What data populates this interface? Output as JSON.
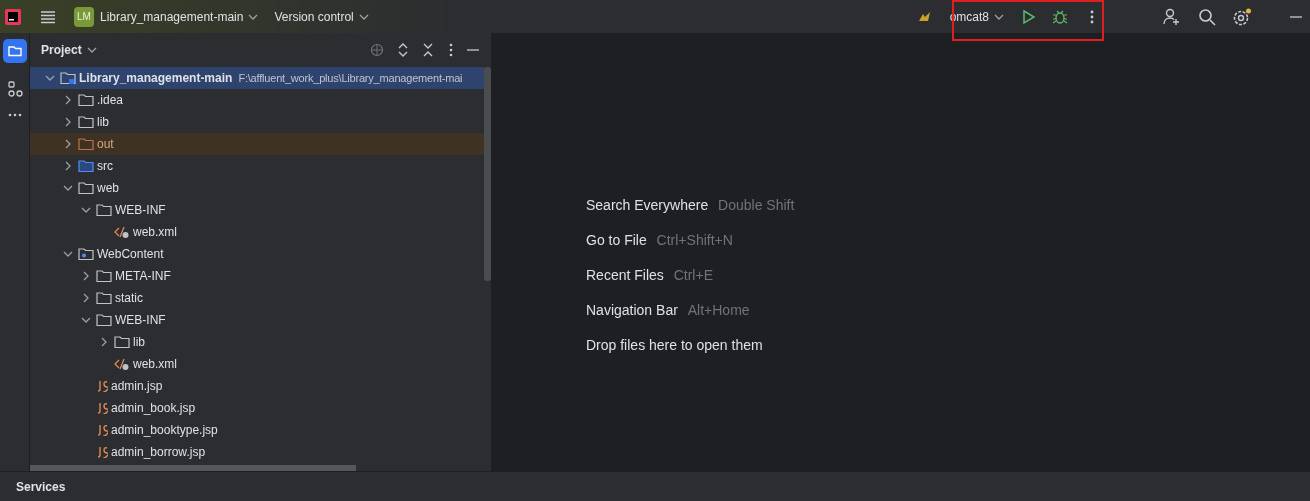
{
  "toolbar": {
    "project_badge": "LM",
    "project_name": "Library_management-main",
    "vcs": "Version control",
    "run_config": "omcat8"
  },
  "project_panel": {
    "title": "Project",
    "tree": [
      {
        "name": "Library_management-main",
        "path": "F:\\affluent_work_plus\\Library_management-mai",
        "kind": "module",
        "expanded": true,
        "selected": true,
        "excluded": false,
        "children": [
          {
            "name": ".idea",
            "kind": "folder",
            "expanded": false,
            "selected": false,
            "excluded": false
          },
          {
            "name": "lib",
            "kind": "folder",
            "expanded": false,
            "selected": false,
            "excluded": false
          },
          {
            "name": "out",
            "kind": "folder",
            "expanded": false,
            "selected": false,
            "excluded": true
          },
          {
            "name": "src",
            "kind": "source-folder",
            "expanded": false,
            "selected": false,
            "excluded": false
          },
          {
            "name": "web",
            "kind": "folder",
            "expanded": true,
            "selected": false,
            "excluded": false,
            "children": [
              {
                "name": "WEB-INF",
                "kind": "folder",
                "expanded": true,
                "selected": false,
                "excluded": false,
                "children": [
                  {
                    "name": "web.xml",
                    "kind": "xml",
                    "selected": false,
                    "excluded": false
                  }
                ]
              }
            ]
          },
          {
            "name": "WebContent",
            "kind": "web-folder",
            "expanded": true,
            "selected": false,
            "excluded": false,
            "children": [
              {
                "name": "META-INF",
                "kind": "folder",
                "expanded": false,
                "selected": false,
                "excluded": false
              },
              {
                "name": "static",
                "kind": "folder",
                "expanded": false,
                "selected": false,
                "excluded": false
              },
              {
                "name": "WEB-INF",
                "kind": "folder",
                "expanded": true,
                "selected": false,
                "excluded": false,
                "children": [
                  {
                    "name": "lib",
                    "kind": "folder",
                    "expanded": false,
                    "selected": false,
                    "excluded": false
                  },
                  {
                    "name": "web.xml",
                    "kind": "xml",
                    "selected": false,
                    "excluded": false
                  }
                ]
              },
              {
                "name": "admin.jsp",
                "kind": "jsp",
                "selected": false,
                "excluded": false
              },
              {
                "name": "admin_book.jsp",
                "kind": "jsp",
                "selected": false,
                "excluded": false
              },
              {
                "name": "admin_booktype.jsp",
                "kind": "jsp",
                "selected": false,
                "excluded": false
              },
              {
                "name": "admin_borrow.jsp",
                "kind": "jsp",
                "selected": false,
                "excluded": false
              }
            ]
          }
        ]
      }
    ]
  },
  "editor_hints": [
    {
      "action": "Search Everywhere",
      "shortcut": "Double Shift"
    },
    {
      "action": "Go to File",
      "shortcut": "Ctrl+Shift+N"
    },
    {
      "action": "Recent Files",
      "shortcut": "Ctrl+E"
    },
    {
      "action": "Navigation Bar",
      "shortcut": "Alt+Home"
    },
    {
      "action": "Drop files here to open them"
    }
  ],
  "bottom_panel": {
    "title": "Services"
  }
}
